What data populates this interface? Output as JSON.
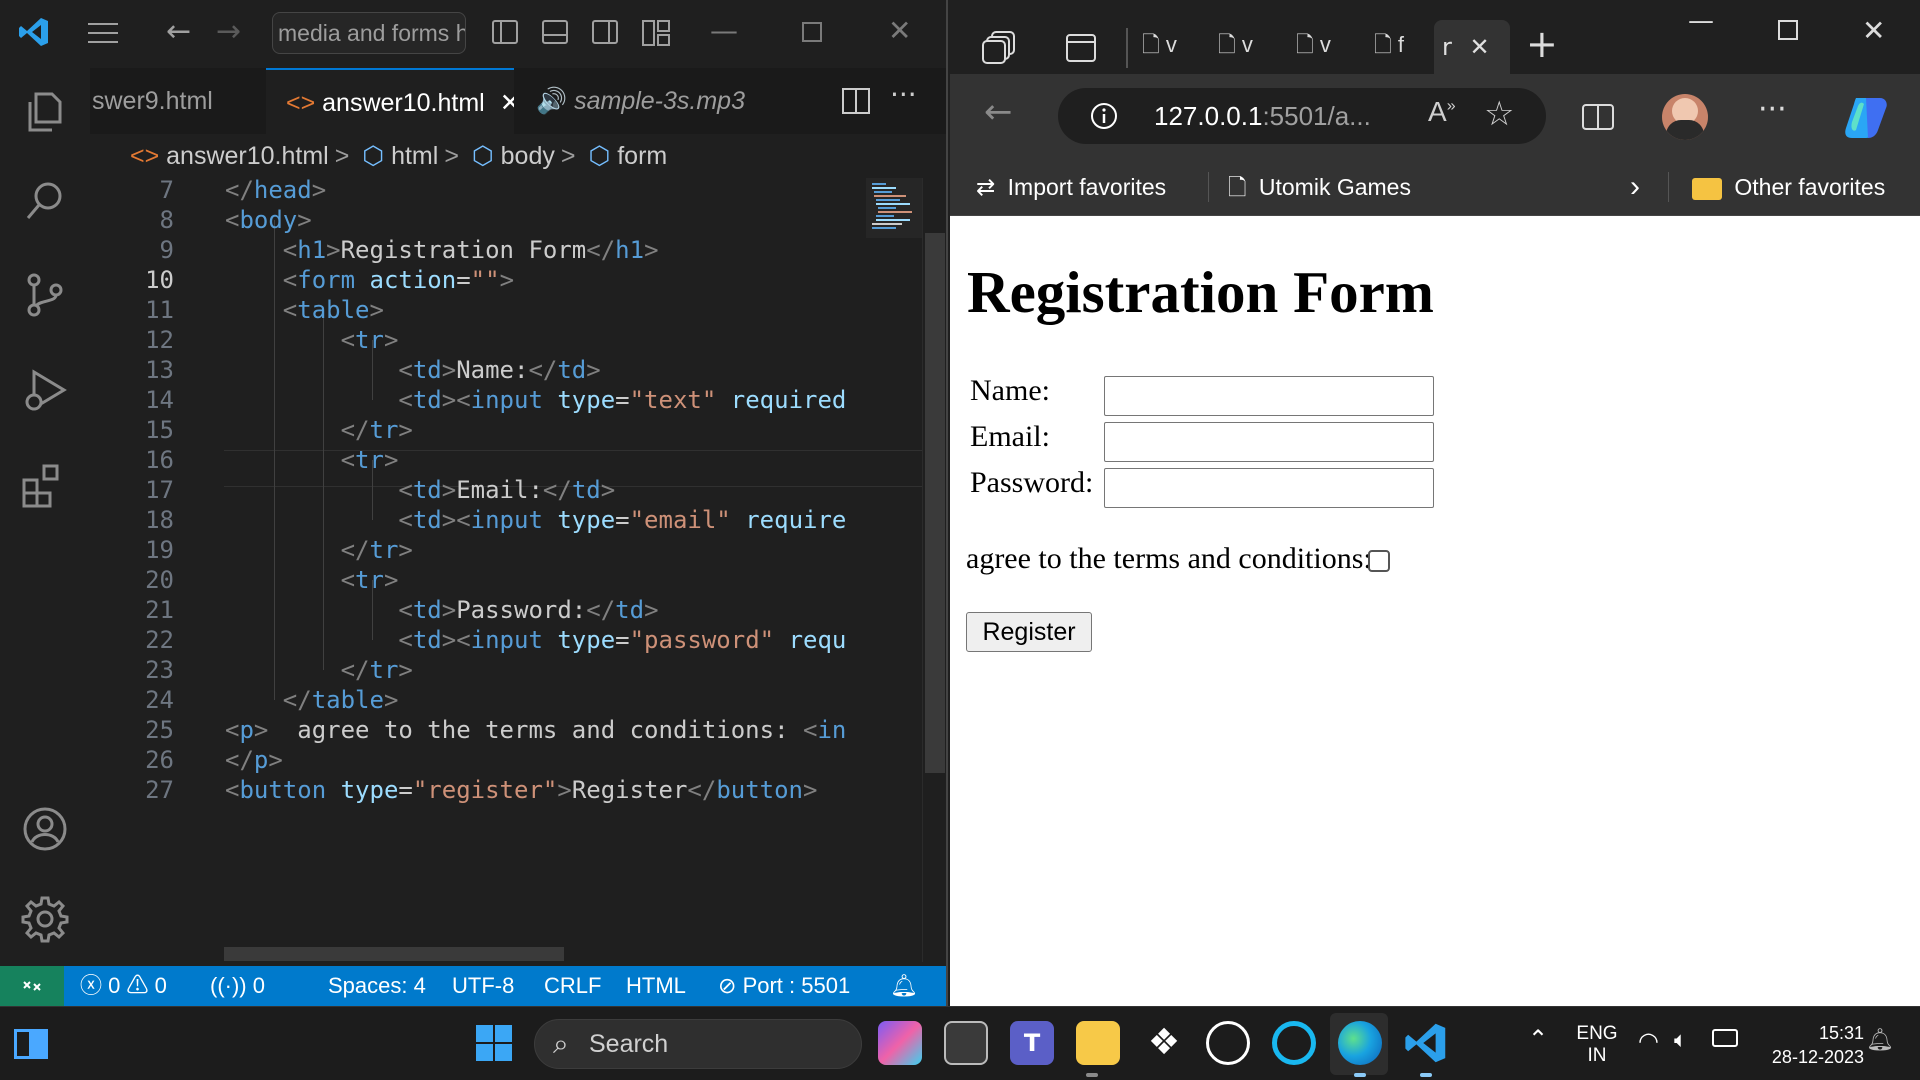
{
  "vscode": {
    "command_center": "media and forms h",
    "tabs": [
      {
        "label": "swer9.html"
      },
      {
        "label": "answer10.html"
      },
      {
        "label": "sample-3s.mp3"
      }
    ],
    "breadcrumb": [
      "answer10.html",
      "html",
      "body",
      "form"
    ],
    "code_lines": [
      {
        "n": "7"
      },
      {
        "n": "8"
      },
      {
        "n": "9"
      },
      {
        "n": "10"
      },
      {
        "n": "11"
      },
      {
        "n": "12"
      },
      {
        "n": "13"
      },
      {
        "n": "14"
      },
      {
        "n": "15"
      },
      {
        "n": "16"
      },
      {
        "n": "17"
      },
      {
        "n": "18"
      },
      {
        "n": "19"
      },
      {
        "n": "20"
      },
      {
        "n": "21"
      },
      {
        "n": "22"
      },
      {
        "n": "23"
      },
      {
        "n": "24"
      },
      {
        "n": "25"
      },
      {
        "n": "26"
      },
      {
        "n": "27"
      }
    ],
    "status": {
      "errors": "0",
      "warnings": "0",
      "ports": "0",
      "spaces": "Spaces: 4",
      "encoding": "UTF-8",
      "eol": "CRLF",
      "language": "HTML",
      "port": "Port : 5501"
    }
  },
  "browser": {
    "url_host": "127.0.0.1",
    "url_rest": ":5501/a...",
    "tab_letters": [
      "v",
      "v",
      "v",
      "f",
      "r"
    ],
    "favorites": {
      "import": "Import favorites",
      "utomik": "Utomik Games",
      "other": "Other favorites"
    },
    "page": {
      "title": "Registration Form",
      "name_label": "Name:",
      "email_label": "Email:",
      "password_label": "Password:",
      "agree_text": "agree to the terms and conditions:",
      "register_button": "Register"
    }
  },
  "taskbar": {
    "search": "Search",
    "lang": "ENG",
    "region": "IN",
    "time": "15:31",
    "date": "28-12-2023"
  },
  "colors": {
    "statusbar": "#007acc",
    "remote": "#16825d",
    "vscode_bg": "#1f1f1f",
    "accent": "#0078d4"
  }
}
